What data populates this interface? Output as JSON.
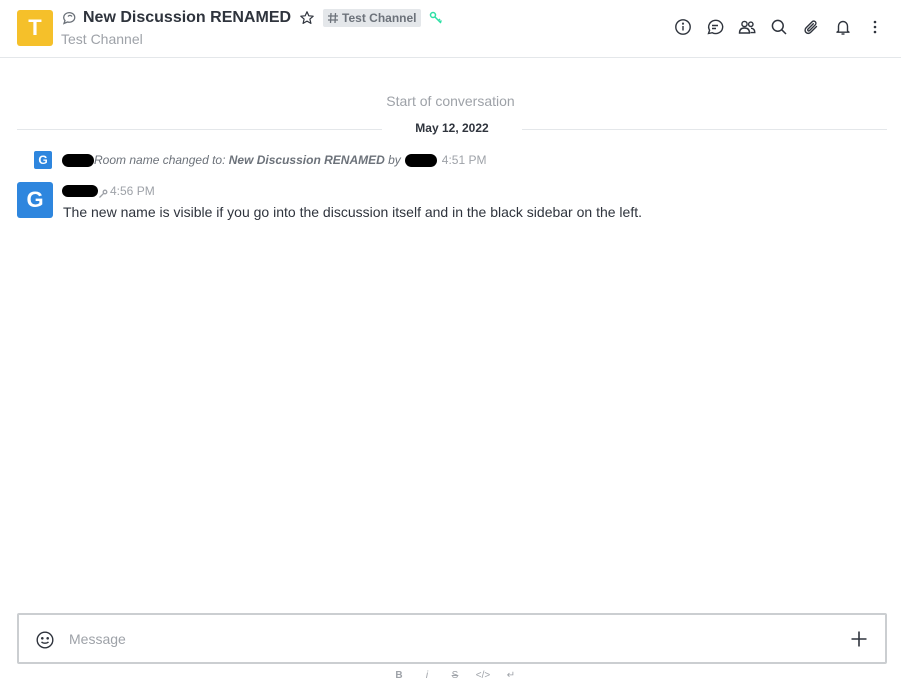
{
  "header": {
    "avatar_letter": "T",
    "title": "New Discussion RENAMED",
    "parent_channel": "Test Channel",
    "subtitle": "Test Channel",
    "toolbar": [
      "info-icon",
      "threads-icon",
      "members-icon",
      "search-icon",
      "files-icon",
      "bell-icon",
      "kebab-icon"
    ]
  },
  "conversation": {
    "start_label": "Start of conversation",
    "date_divider": "May 12, 2022"
  },
  "system_message": {
    "avatar_letter": "G",
    "prefix": "Room name changed to: ",
    "new_name": "New Discussion RENAMED",
    "by": " by",
    "time": "4:51 PM"
  },
  "message": {
    "avatar_letter": "G",
    "time": "4:56 PM",
    "text": "The new name is visible if you go into the discussion itself and in the black sidebar on the left."
  },
  "composer": {
    "placeholder": "Message",
    "formatting": [
      "B",
      "i",
      "S",
      "</>",
      "↵"
    ]
  },
  "colors": {
    "room_avatar": "#f5c02a",
    "user_avatar": "#2e86de",
    "key_icon": "#2de0a5"
  }
}
